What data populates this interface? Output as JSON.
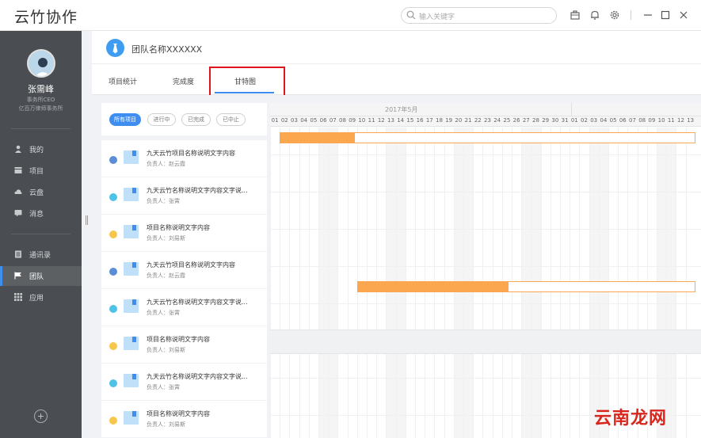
{
  "app": {
    "title": "云竹协作"
  },
  "search": {
    "placeholder": "输入关键字"
  },
  "user": {
    "name": "张需峰",
    "role": "事务所CEO",
    "org": "亿百万律师事务所"
  },
  "nav": {
    "group1": [
      {
        "label": "我的",
        "icon": "user-icon"
      },
      {
        "label": "项目",
        "icon": "project-icon"
      },
      {
        "label": "云盘",
        "icon": "cloud-icon"
      },
      {
        "label": "消息",
        "icon": "message-icon"
      }
    ],
    "group2": [
      {
        "label": "通讯录",
        "icon": "contacts-icon"
      },
      {
        "label": "团队",
        "icon": "flag-icon",
        "active": true
      },
      {
        "label": "应用",
        "icon": "apps-icon"
      }
    ]
  },
  "team": {
    "name": "团队名称XXXXXX"
  },
  "tabs": [
    {
      "label": "项目统计"
    },
    {
      "label": "完成度"
    },
    {
      "label": "甘特图",
      "active": true
    }
  ],
  "filters": [
    {
      "label": "所有项目",
      "active": true
    },
    {
      "label": "进行中"
    },
    {
      "label": "已完成"
    },
    {
      "label": "已中止"
    }
  ],
  "projects": [
    {
      "title": "九天云竹项目名称说明文字内容",
      "owner": "负责人：赵云霞",
      "status_color": "#5b8ed6"
    },
    {
      "title": "九天云竹名称说明文字内容文字说...",
      "owner": "负责人：张霄",
      "status_color": "#4dc3e8"
    },
    {
      "title": "项目名称说明文字内容",
      "owner": "负责人：刘易斯",
      "status_color": "#f7c64b"
    },
    {
      "title": "九天云竹项目名称说明文字内容",
      "owner": "负责人：赵云霞",
      "status_color": "#5b8ed6"
    },
    {
      "title": "九天云竹名称说明文字内容文字说...",
      "owner": "负责人：张霄",
      "status_color": "#4dc3e8"
    },
    {
      "title": "项目名称说明文字内容",
      "owner": "负责人：刘易斯",
      "status_color": "#f7c64b"
    },
    {
      "title": "九天云竹名称说明文字内容文字说...",
      "owner": "负责人：张霄",
      "status_color": "#4dc3e8"
    },
    {
      "title": "项目名称说明文字内容",
      "owner": "负责人：刘易斯",
      "status_color": "#f7c64b"
    }
  ],
  "gantt": {
    "month_label": "2017年5月",
    "days": [
      "01",
      "02",
      "03",
      "04",
      "05",
      "06",
      "07",
      "08",
      "09",
      "10",
      "11",
      "12",
      "13",
      "14",
      "15",
      "16",
      "17",
      "18",
      "19",
      "20",
      "21",
      "22",
      "23",
      "24",
      "25",
      "26",
      "27",
      "28",
      "29",
      "30",
      "31",
      "01",
      "02",
      "03",
      "04",
      "05",
      "06",
      "07",
      "08",
      "09",
      "10",
      "11",
      "12",
      "13"
    ],
    "weekend_indexes": [
      5,
      6,
      12,
      13,
      19,
      20,
      26,
      27,
      33,
      34,
      40,
      41
    ],
    "bars": [
      {
        "row": 0,
        "start_day_index": 1,
        "done_days": 7.8
      },
      {
        "row": 4,
        "start_day_index": 9,
        "done_days": 15.7
      }
    ],
    "bar_color": "#fba74f"
  },
  "watermark": "云南龙网",
  "colors": {
    "accent": "#3d8ef0",
    "sidebar": "#4a4d51",
    "gantt_bar": "#fba74f",
    "highlight_box": "#e0141e"
  }
}
